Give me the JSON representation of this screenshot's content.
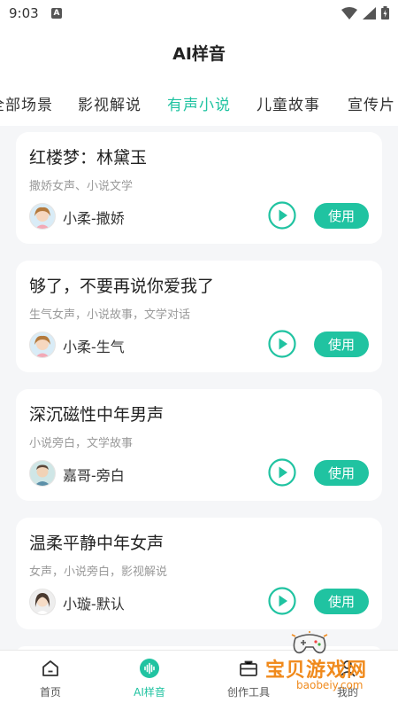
{
  "status_bar": {
    "time": "9:03",
    "notification_letter": "A"
  },
  "header": {
    "title": "AI样音"
  },
  "tabs": [
    {
      "label": "全部场景",
      "active": false
    },
    {
      "label": "影视解说",
      "active": false
    },
    {
      "label": "有声小说",
      "active": true
    },
    {
      "label": "儿童故事",
      "active": false
    },
    {
      "label": "宣传片",
      "active": false
    }
  ],
  "cards": [
    {
      "title": "红楼梦：林黛玉",
      "desc": "撒娇女声、小说文学",
      "voice": "小柔-撒娇",
      "avatar": "female-avatar-icon",
      "use_label": "使用"
    },
    {
      "title": "够了，不要再说你爱我了",
      "desc": "生气女声，小说故事，文学对话",
      "voice": "小柔-生气",
      "avatar": "female-avatar-icon",
      "use_label": "使用"
    },
    {
      "title": "深沉磁性中年男声",
      "desc": "小说旁白，文学故事",
      "voice": "嘉哥-旁白",
      "avatar": "male-avatar-icon",
      "use_label": "使用"
    },
    {
      "title": "温柔平静中年女声",
      "desc": "女声，小说旁白，影视解说",
      "voice": "小璇-默认",
      "avatar": "female-avatar-icon",
      "use_label": "使用"
    }
  ],
  "bottom_nav": [
    {
      "label": "首页",
      "icon": "home-icon",
      "active": false
    },
    {
      "label": "AI样音",
      "icon": "voice-wave-icon",
      "active": true
    },
    {
      "label": "创作工具",
      "icon": "toolbox-icon",
      "active": false
    },
    {
      "label": "我的",
      "icon": "profile-icon",
      "active": false
    }
  ],
  "watermark": {
    "text": "宝贝游戏网",
    "url": "baobeiy.com"
  },
  "colors": {
    "accent": "#20c3a1",
    "background": "#f5f6f8",
    "watermark": "#f08a1c"
  }
}
